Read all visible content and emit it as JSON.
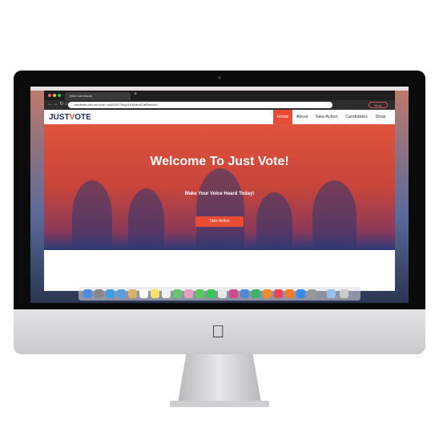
{
  "browser": {
    "tab_title": "blind cat rescue",
    "url": "students.cah.ucf.edu/~ca641917/dig4104/blindCatRescue/",
    "error_label": "Error"
  },
  "site": {
    "logo_prefix": "JUST",
    "logo_check": "V",
    "logo_suffix": "OTE",
    "nav": [
      {
        "label": "Home",
        "active": true
      },
      {
        "label": "About"
      },
      {
        "label": "Take Action"
      },
      {
        "label": "Candidates"
      },
      {
        "label": "Shop"
      }
    ],
    "hero": {
      "title": "Welcome To Just Vote!",
      "subtitle": "Make Your Voice Heard Today!",
      "cta": "Take Action"
    }
  },
  "colors": {
    "accent": "#e84c35",
    "brand_navy": "#1d2a5c"
  }
}
